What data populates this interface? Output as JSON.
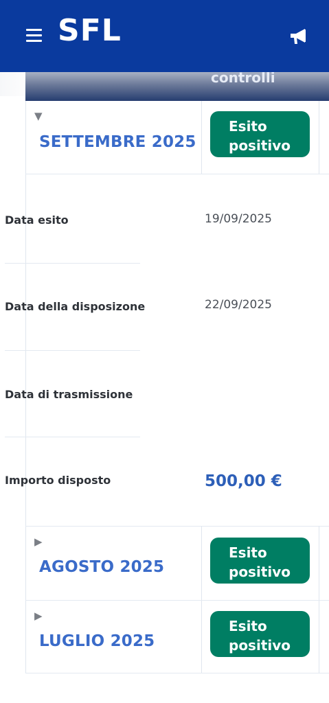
{
  "app": {
    "brand": "SFL"
  },
  "icons": {
    "menu": "hamburger-menu-icon",
    "announcement": "megaphone-icon"
  },
  "colors": {
    "header": "#0a3a9e",
    "accent_text": "#3a6bc9",
    "badge": "#007e63"
  },
  "table": {
    "column_header_partial": "controlli"
  },
  "months": [
    {
      "label": "SETTEMBRE 2025",
      "expanded": true,
      "badge_line1": "Esito",
      "badge_line2": "positivo"
    },
    {
      "label": "AGOSTO 2025",
      "expanded": false,
      "badge_line1": "Esito",
      "badge_line2": "positivo"
    },
    {
      "label": "LUGLIO 2025",
      "expanded": false,
      "badge_line1": "Esito",
      "badge_line2": "positivo"
    }
  ],
  "details": {
    "data_esito": {
      "label": "Data esito",
      "value": "19/09/2025"
    },
    "data_disposizione": {
      "label": "Data della disposizone",
      "value": "22/09/2025"
    },
    "data_trasmissione": {
      "label": "Data di trasmissione",
      "value": ""
    },
    "importo": {
      "label": "Importo disposto",
      "value": "500,00 €"
    }
  },
  "glyphs": {
    "expanded": "▼",
    "collapsed": "▶"
  }
}
